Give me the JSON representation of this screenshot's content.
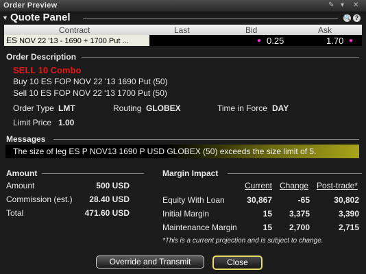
{
  "window": {
    "title": "Order Preview"
  },
  "panel": {
    "title": "Quote Panel"
  },
  "quote_table": {
    "columns": [
      "Contract",
      "Last",
      "Bid",
      "Ask"
    ],
    "row": {
      "symbol": "ES",
      "contract": "NOV 22 '13 - 1690 + 1700 Put ...",
      "last": "",
      "bid": "0.25",
      "ask": "1.70"
    }
  },
  "order_description": {
    "heading": "Order Description",
    "action": "SELL 10 Combo",
    "legs": [
      "Buy 10 ES FOP NOV 22 '13 1690 Put (50)",
      "Sell 10 ES FOP NOV 22 '13 1700 Put (50)"
    ],
    "order_type_label": "Order Type",
    "order_type": "LMT",
    "routing_label": "Routing",
    "routing": "GLOBEX",
    "tif_label": "Time in Force",
    "tif": "DAY",
    "limit_price_label": "Limit Price",
    "limit_price": "1.00"
  },
  "messages": {
    "heading": "Messages",
    "text": "The size of leg ES P NOV13 1690 P USD GLOBEX  (50) exceeds the size limit of 5."
  },
  "amount": {
    "heading": "Amount",
    "rows": [
      {
        "label": "Amount",
        "value": "500 USD"
      },
      {
        "label": "Commission (est.)",
        "value": "28.40 USD"
      },
      {
        "label": "Total",
        "value": "471.60 USD"
      }
    ]
  },
  "margin": {
    "heading": "Margin Impact",
    "columns": [
      "Current",
      "Change",
      "Post-trade*"
    ],
    "rows": [
      {
        "label": "Equity With Loan",
        "current": "30,867",
        "change": "-65",
        "post": "30,802"
      },
      {
        "label": "Initial Margin",
        "current": "15",
        "change": "3,375",
        "post": "3,390"
      },
      {
        "label": "Maintenance Margin",
        "current": "15",
        "change": "2,700",
        "post": "2,715"
      }
    ],
    "note": "*This is a current projection and is subject to change."
  },
  "buttons": {
    "override": "Override and Transmit",
    "close": "Close"
  },
  "colors": {
    "accent_red": "#e01818",
    "bid_ask_dot": "#ff2fd6",
    "close_border": "#e8dc6c"
  }
}
